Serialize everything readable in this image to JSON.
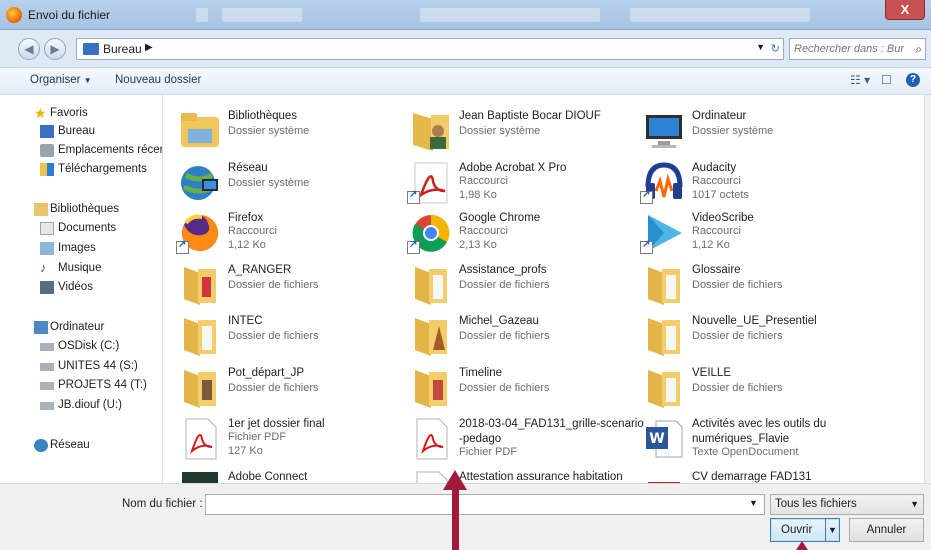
{
  "window": {
    "title": "Envoi du fichier",
    "close_glyph": "X"
  },
  "address": {
    "crumb": "Bureau",
    "search_placeholder": "Rechercher dans : Bureau"
  },
  "toolbar": {
    "organize": "Organiser",
    "new_folder": "Nouveau dossier"
  },
  "nav": {
    "favorites": "Favoris",
    "fav_items": [
      "Bureau",
      "Emplacements récen",
      "Téléchargements"
    ],
    "libraries": "Bibliothèques",
    "lib_items": [
      "Documents",
      "Images",
      "Musique",
      "Vidéos"
    ],
    "computer": "Ordinateur",
    "comp_items": [
      "OSDisk (C:)",
      "UNITES 44 (S:)",
      "PROJETS 44 (T:)",
      "JB.diouf (U:)"
    ],
    "network": "Réseau"
  },
  "files": [
    {
      "name": "Bibliothèques",
      "l1": "Dossier système",
      "icon": "library-icon"
    },
    {
      "name": "Jean Baptiste Bocar DIOUF",
      "l1": "Dossier système",
      "icon": "user-folder-icon"
    },
    {
      "name": "Ordinateur",
      "l1": "Dossier système",
      "icon": "computer-icon"
    },
    {
      "name": "Réseau",
      "l1": "Dossier système",
      "icon": "network-icon"
    },
    {
      "name": "Adobe Acrobat X Pro",
      "l1": "Raccourci",
      "l2": "1,98 Ko",
      "icon": "acrobat-icon"
    },
    {
      "name": "Audacity",
      "l1": "Raccourci",
      "l2": "1017 octets",
      "icon": "audacity-icon"
    },
    {
      "name": "Firefox",
      "l1": "Raccourci",
      "l2": "1,12 Ko",
      "icon": "firefox-icon"
    },
    {
      "name": "Google Chrome",
      "l1": "Raccourci",
      "l2": "2,13 Ko",
      "icon": "chrome-icon"
    },
    {
      "name": "VideoScribe",
      "l1": "Raccourci",
      "l2": "1,12 Ko",
      "icon": "videoscribe-icon"
    },
    {
      "name": "A_RANGER",
      "l1": "Dossier de fichiers",
      "icon": "folder-icon"
    },
    {
      "name": "Assistance_profs",
      "l1": "Dossier de fichiers",
      "icon": "folder-icon"
    },
    {
      "name": "Glossaire",
      "l1": "Dossier de fichiers",
      "icon": "folder-icon"
    },
    {
      "name": "INTEC",
      "l1": "Dossier de fichiers",
      "icon": "folder-icon"
    },
    {
      "name": "Michel_Gazeau",
      "l1": "Dossier de fichiers",
      "icon": "folder-icon"
    },
    {
      "name": "Nouvelle_UE_Presentiel",
      "l1": "Dossier de fichiers",
      "icon": "folder-icon"
    },
    {
      "name": "Pot_départ_JP",
      "l1": "Dossier de fichiers",
      "icon": "folder-icon"
    },
    {
      "name": "Timeline",
      "l1": "Dossier de fichiers",
      "icon": "folder-icon"
    },
    {
      "name": "VEILLE",
      "l1": "Dossier de fichiers",
      "icon": "folder-icon"
    },
    {
      "name": "1er jet dossier final",
      "l1": "Fichier PDF",
      "l2": "127 Ko",
      "icon": "pdf-icon"
    },
    {
      "name": "2018-03-04_FAD131_grille-scenario",
      "name2": "-pedago",
      "l1": "Fichier PDF",
      "icon": "pdf-icon"
    },
    {
      "name": "Activités avec les outils du",
      "name2": "numériques_Flavie",
      "l1": "Texte OpenDocument",
      "icon": "word-icon"
    },
    {
      "name": "Adobe Connect",
      "icon": "adobe-connect-icon"
    },
    {
      "name": "Attestation assurance habitation",
      "icon": "document-icon"
    },
    {
      "name": "CV demarrage FAD131",
      "icon": "document-icon"
    }
  ],
  "bottom": {
    "filename_label": "Nom du fichier :",
    "filename_value": "",
    "filter": "Tous les fichiers",
    "open": "Ouvrir",
    "cancel": "Annuler"
  }
}
